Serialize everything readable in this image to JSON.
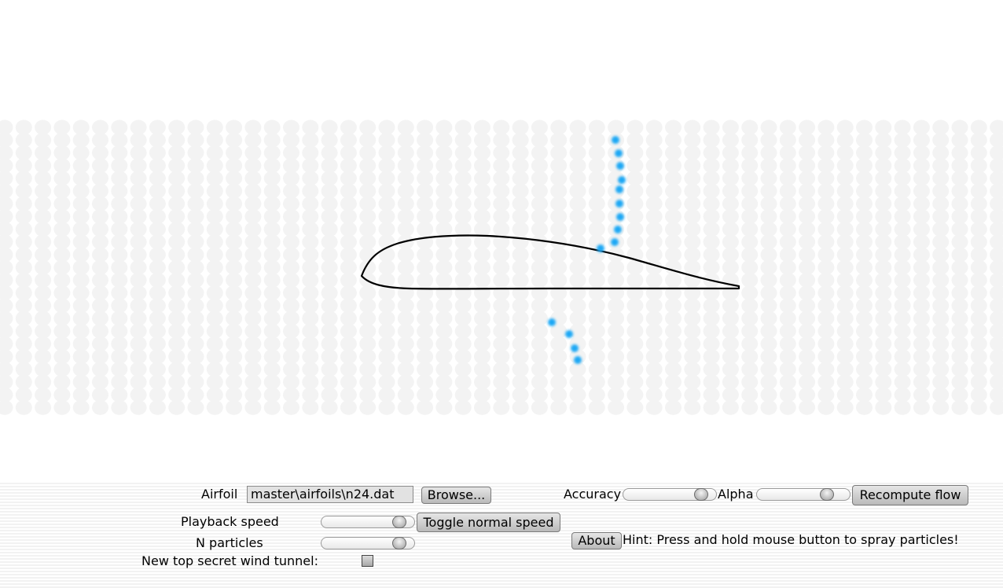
{
  "simulation": {
    "particle_color": "#1ea8f5",
    "airfoil_color": "#000000",
    "grid_color": "#f3f3f3"
  },
  "controls": {
    "airfoil": {
      "label": "Airfoil",
      "path_value": "master\\airfoils\\n24.dat",
      "browse_label": "Browse..."
    },
    "accuracy": {
      "label": "Accuracy",
      "level": 0.9
    },
    "alpha": {
      "label": "Alpha",
      "level": 0.8
    },
    "recompute_label": "Recompute flow",
    "playback_speed": {
      "label": "Playback speed",
      "level": 0.9
    },
    "toggle_speed_label": "Toggle normal speed",
    "n_particles": {
      "label": "N particles",
      "level": 0.9
    },
    "wind_tunnel": {
      "label": "New top secret wind tunnel:",
      "checked": false
    },
    "about_label": "About",
    "hint": "Hint: Press and hold mouse button to spray particles!"
  }
}
